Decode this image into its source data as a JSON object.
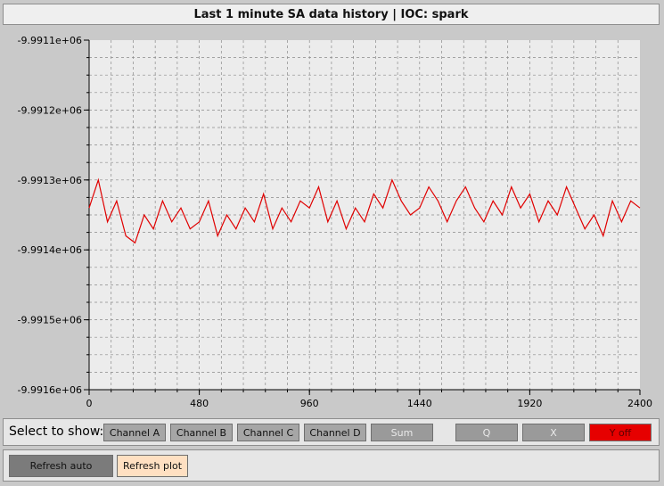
{
  "title": "Last 1 minute SA data history | IOC: spark",
  "controls": {
    "select_label": "Select to show:",
    "buttons": [
      "Channel A",
      "Channel B",
      "Channel C",
      "Channel D",
      "Sum",
      "Q",
      "X",
      "Y off"
    ]
  },
  "bottom": {
    "refresh_auto": "Refresh auto",
    "refresh_plot": "Refresh plot"
  },
  "colors": {
    "series": "#e00000",
    "plot_bg": "#ececec",
    "y_off_active": "#e60000"
  },
  "chart_data": {
    "type": "line",
    "title": "",
    "xlabel": "",
    "ylabel": "",
    "xlim": [
      0,
      2400
    ],
    "ylim": [
      -9991600.0,
      -9991100.0
    ],
    "x_ticks": [
      0,
      480,
      960,
      1440,
      1920,
      2400
    ],
    "x_tick_labels": [
      "0",
      "480",
      "960",
      "1440",
      "1920",
      "2400"
    ],
    "y_ticks": [
      -9991100.0,
      -9991200.0,
      -9991300.0,
      -9991400.0,
      -9991500.0,
      -9991600.0
    ],
    "y_tick_labels": [
      "-9.9911e+06",
      "-9.9912e+06",
      "-9.9913e+06",
      "-9.9914e+06",
      "-9.9915e+06",
      "-9.9916e+06"
    ],
    "grid": true,
    "series": [
      {
        "color": "#e00000",
        "x": [
          0,
          40,
          80,
          120,
          160,
          200,
          240,
          280,
          320,
          360,
          400,
          440,
          480,
          520,
          560,
          600,
          640,
          680,
          720,
          760,
          800,
          840,
          880,
          920,
          960,
          1000,
          1040,
          1080,
          1120,
          1160,
          1200,
          1240,
          1280,
          1320,
          1360,
          1400,
          1440,
          1480,
          1520,
          1560,
          1600,
          1640,
          1680,
          1720,
          1760,
          1800,
          1840,
          1880,
          1920,
          1960,
          2000,
          2040,
          2080,
          2120,
          2160,
          2200,
          2240,
          2280,
          2320,
          2360,
          2400
        ],
        "values": [
          -9991340.0,
          -9991300.0,
          -9991360.0,
          -9991330.0,
          -9991380.0,
          -9991390.0,
          -9991350.0,
          -9991370.0,
          -9991330.0,
          -9991360.0,
          -9991340.0,
          -9991370.0,
          -9991360.0,
          -9991330.0,
          -9991380.0,
          -9991350.0,
          -9991370.0,
          -9991340.0,
          -9991360.0,
          -9991320.0,
          -9991370.0,
          -9991340.0,
          -9991360.0,
          -9991330.0,
          -9991340.0,
          -9991310.0,
          -9991360.0,
          -9991330.0,
          -9991370.0,
          -9991340.0,
          -9991360.0,
          -9991320.0,
          -9991340.0,
          -9991300.0,
          -9991330.0,
          -9991350.0,
          -9991340.0,
          -9991310.0,
          -9991330.0,
          -9991360.0,
          -9991330.0,
          -9991310.0,
          -9991340.0,
          -9991360.0,
          -9991330.0,
          -9991350.0,
          -9991310.0,
          -9991340.0,
          -9991320.0,
          -9991360.0,
          -9991330.0,
          -9991350.0,
          -9991310.0,
          -9991340.0,
          -9991370.0,
          -9991350.0,
          -9991380.0,
          -9991330.0,
          -9991360.0,
          -9991330.0,
          -9991340.0
        ]
      }
    ]
  }
}
